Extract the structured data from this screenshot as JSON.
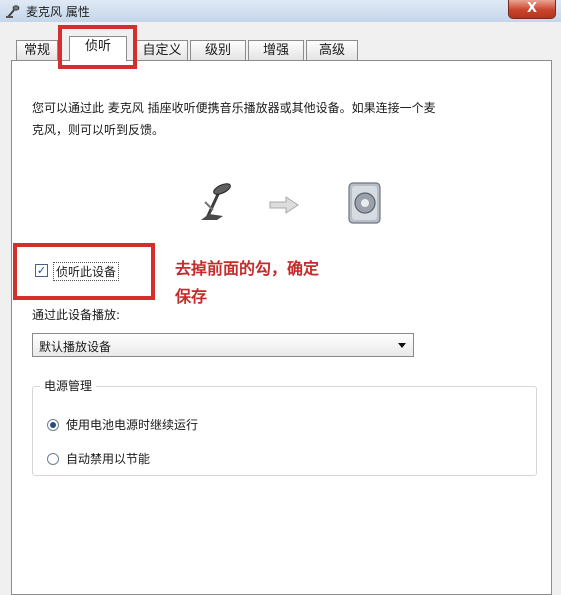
{
  "window": {
    "title": "麦克风 属性",
    "close_label": "X"
  },
  "tabs": [
    {
      "label": "常规",
      "active": false
    },
    {
      "label": "侦听",
      "active": true
    },
    {
      "label": "自定义",
      "active": false
    },
    {
      "label": "级别",
      "active": false
    },
    {
      "label": "增强",
      "active": false
    },
    {
      "label": "高级",
      "active": false
    }
  ],
  "listen": {
    "description_line1": "您可以通过此 麦克风 插座收听便携音乐播放器或其他设备。如果连接一个麦",
    "description_line2": "克风，则可以听到反馈。",
    "checkbox_label": "侦听此设备",
    "checkbox_checked": true,
    "playback_label": "通过此设备播放:",
    "playback_device": "默认播放设备"
  },
  "power": {
    "title": "电源管理",
    "options": [
      {
        "label": "使用电池电源时继续运行",
        "selected": true
      },
      {
        "label": "自动禁用以节能",
        "selected": false
      }
    ]
  },
  "annotation": {
    "line1": "去掉前面的勾，确定",
    "line2": "保存",
    "color": "#d42f2f"
  },
  "icons": {
    "window": "microphone-icon",
    "source": "microphone-icon",
    "arrow": "arrow-right-icon",
    "target": "speaker-icon"
  }
}
